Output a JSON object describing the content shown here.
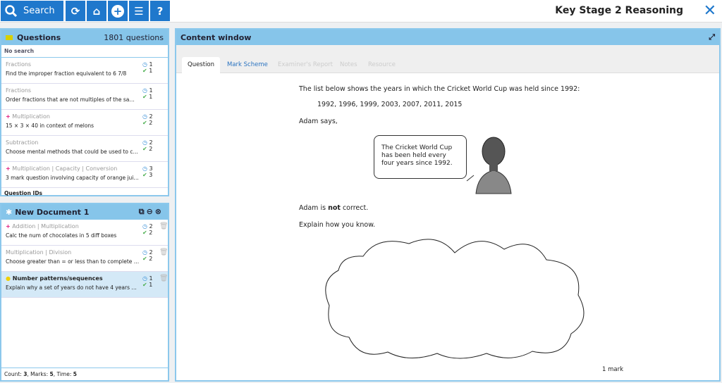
{
  "toolbar": {
    "search_label": "Search",
    "title": "Key Stage 2 Reasoning"
  },
  "questions": {
    "title": "Questions",
    "count": "1801 questions",
    "search_status": "No search",
    "footer": "Question IDs",
    "items": [
      {
        "category": "Fractions",
        "desc": "Find the improper fraction equivalent to 6 7/8",
        "time": "1",
        "marks": "1",
        "marker": ""
      },
      {
        "category": "Fractions",
        "desc": "Order fractions that are not multiples of the same num...",
        "time": "1",
        "marks": "1",
        "marker": ""
      },
      {
        "category": "Multiplication",
        "desc": "15 × 3 × 40 in context of melons",
        "time": "2",
        "marks": "2",
        "marker": "+"
      },
      {
        "category": "Subtraction",
        "desc": "Choose mental methods that could be used to calcula...",
        "time": "2",
        "marks": "2",
        "marker": ""
      },
      {
        "category": "Multiplication | Capacity | Conversion",
        "desc": "3 mark question involving capacity of orange juice",
        "time": "3",
        "marks": "3",
        "marker": "+"
      }
    ]
  },
  "document": {
    "title": "New Document 1",
    "items": [
      {
        "category": "Addition | Multiplication",
        "desc": "Calc the num of chocolates in 5 diff boxes",
        "time": "2",
        "marks": "2",
        "marker": "+"
      },
      {
        "category": "Multiplication | Division",
        "desc": "Choose greater than = or less than to complete numbe...",
        "time": "2",
        "marks": "2",
        "marker": ""
      },
      {
        "category": "Number patterns/sequences",
        "desc": "Explain why a set of years do not have 4 years betwee...",
        "time": "1",
        "marks": "1",
        "marker": "●"
      }
    ],
    "footer": {
      "count_label": "Count: ",
      "count": "3",
      "marks_label": ", Marks: ",
      "marks": "5",
      "time_label": ", Time: ",
      "time": "5"
    }
  },
  "content": {
    "title": "Content window",
    "tabs": [
      "Question",
      "Mark Scheme",
      "Examiner's Report",
      "Notes",
      "Resource"
    ],
    "intro": "The list below shows the years in which the Cricket World Cup was held since 1992:",
    "years": "1992, 1996, 1999, 2003, 2007, 2011, 2015",
    "adam_says": "Adam says,",
    "speech": "The Cricket World Cup has been held every four years since 1992.",
    "adam_is": "Adam is ",
    "not": "not",
    "correct": " correct.",
    "explain": "Explain how you know.",
    "marks": "1 mark"
  }
}
